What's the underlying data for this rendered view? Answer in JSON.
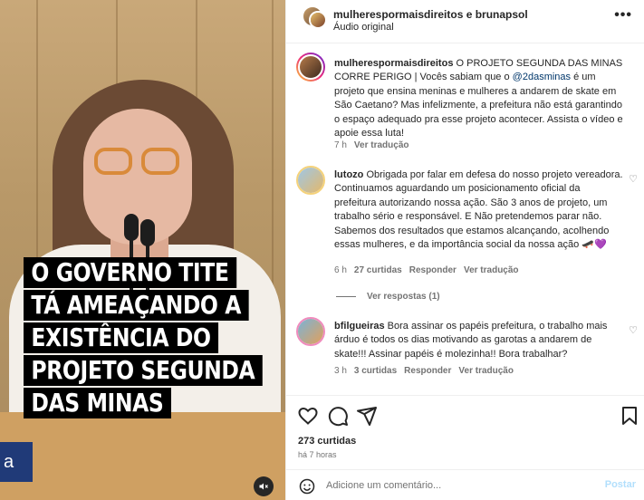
{
  "video": {
    "overlay_lines": [
      "O GOVERNO TITE",
      "TÁ AMEAÇANDO A",
      "EXISTÊNCIA DO",
      "PROJETO SEGUNDA",
      "DAS MINAS"
    ],
    "name_tag_text": "a",
    "mute_icon": "speaker-muted-icon"
  },
  "header": {
    "usernames": "mulherespormaisdireitos e brunapsol",
    "subtitle": "Áudio original",
    "more_icon": "•••"
  },
  "caption": {
    "username": "mulherespormaisdireitos",
    "text_before_mention": " O PROJETO SEGUNDA DAS MINAS CORRE PERIGO | Vocês sabiam que o ",
    "mention": "@2dasminas",
    "text_after_mention": " é um projeto que ensina meninas e mulheres a andarem de skate em São Caetano? Mas infelizmente, a prefeitura não está garantindo o espaço adequado pra esse projeto acontecer. Assista o vídeo e apoie essa luta!",
    "time": "7 h",
    "translate": "Ver tradução"
  },
  "comments": [
    {
      "username": "lutozo",
      "text": " Obrigada por falar em defesa do nosso projeto vereadora. Continuamos aguardando um posicionamento oficial da prefeitura autorizando nossa ação. São 3 anos de projeto, um trabalho sério e responsável. E Não pretendemos parar não. Sabemos dos resultados que estamos alcançando, acolhendo essas mulheres, e da importância social da nossa ação 🛹💜",
      "time": "6 h",
      "likes": "27 curtidas",
      "reply": "Responder",
      "translate": "Ver tradução",
      "view_replies": "Ver respostas (1)"
    },
    {
      "username": "bfilgueiras",
      "text": " Bora assinar os papéis prefeitura, o trabalho mais árduo é todos os dias motivando as garotas a andarem de skate!!! Assinar papéis é molezinha!! Bora trabalhar?",
      "time": "3 h",
      "likes": "3 curtidas",
      "reply": "Responder",
      "translate": "Ver tradução"
    }
  ],
  "actions": {
    "likes": "273 curtidas",
    "time_ago": "há 7 horas"
  },
  "add_comment": {
    "placeholder": "Adicione um comentário...",
    "post_label": "Postar"
  },
  "colors": {
    "accent_link": "#00376b",
    "post_button": "#b2dffc",
    "meta_text": "#737373"
  }
}
